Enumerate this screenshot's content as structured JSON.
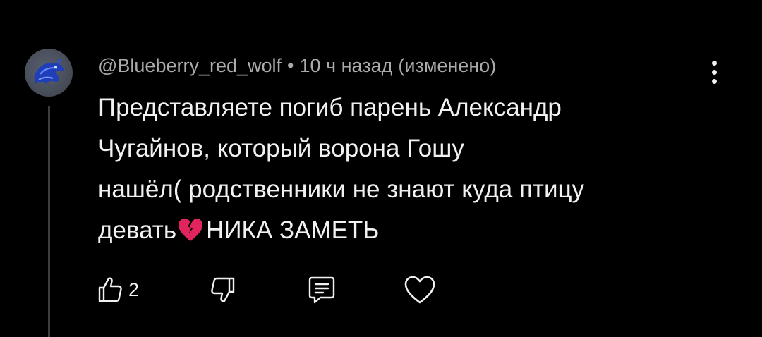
{
  "comment": {
    "author": "@Blueberry_red_wolf",
    "separator": "•",
    "time": "10 ч назад",
    "edited": "(изменено)",
    "text_lines": [
      "Представляете погиб парень Александр",
      "Чугайнов, который ворона Гошу",
      "нашёл( родственники не знают куда птицу",
      "девать"
    ],
    "text_tail": "НИКА ЗАМЕТЬ",
    "emoji_icon": "broken-heart-icon",
    "like_count": "2"
  },
  "actions": {
    "like_icon": "thumbs-up-icon",
    "dislike_icon": "thumbs-down-icon",
    "reply_icon": "reply-comment-icon",
    "heart_icon": "heart-outline-icon",
    "menu_icon": "more-vertical-icon"
  },
  "colors": {
    "background": "#000000",
    "text": "#f1f1f1",
    "meta_text": "#aaaaaa",
    "thread_line": "#3d3d3d",
    "emoji_heart": "#e0245e"
  }
}
